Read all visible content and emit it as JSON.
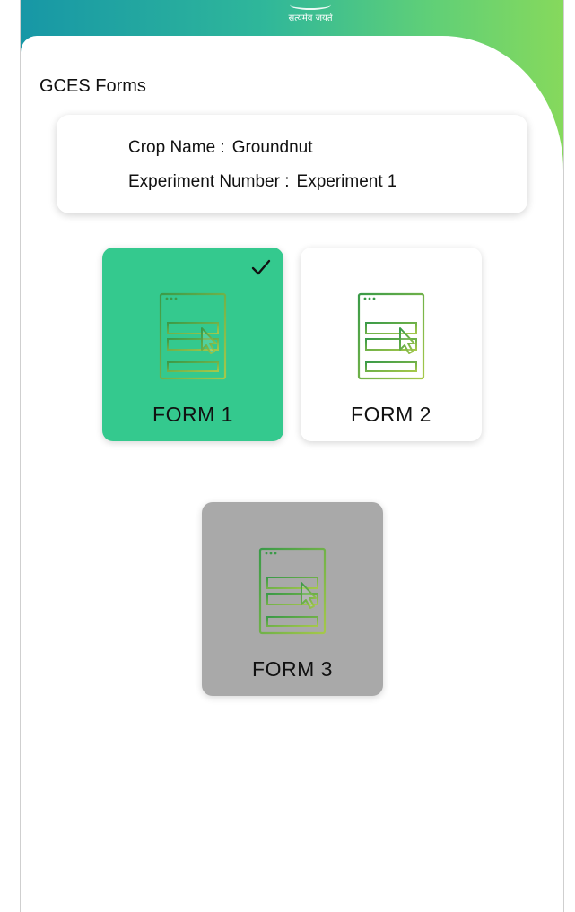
{
  "header": {
    "motto": "सत्यमेव जयते"
  },
  "page": {
    "title": "GCES Forms"
  },
  "info": {
    "crop_label": "Crop Name :",
    "crop_value": "Groundnut",
    "experiment_label": "Experiment Number :",
    "experiment_value": "Experiment 1"
  },
  "forms": [
    {
      "label": "FORM 1",
      "state": "selected",
      "icon": "web-form-cursor-icon"
    },
    {
      "label": "FORM 2",
      "state": "available",
      "icon": "web-form-cursor-icon"
    },
    {
      "label": "FORM 3",
      "state": "disabled",
      "icon": "web-form-cursor-icon"
    }
  ],
  "colors": {
    "header_gradient_start": "#1797a6",
    "header_gradient_end": "#86d95c",
    "selected_card": "#34c98e",
    "disabled_card": "#a9a9a9",
    "icon_gradient_start": "#3a9a48",
    "icon_gradient_end": "#a5c84a"
  }
}
